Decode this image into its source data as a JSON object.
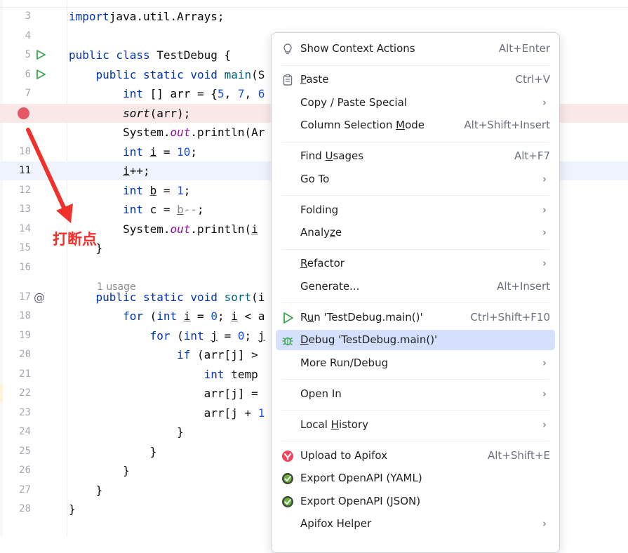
{
  "editor": {
    "usage_hint": "1 usage",
    "line_numbers": [
      "3",
      "4",
      "5",
      "6",
      "7",
      "",
      "",
      "10",
      "11",
      "12",
      "13",
      "14",
      "15",
      "16",
      "17",
      "18",
      "19",
      "20",
      "21",
      "22",
      "23",
      "24",
      "25",
      "26",
      "27",
      "28"
    ],
    "lines": [
      {
        "ln": "3",
        "parts": [
          [
            "kw",
            "import"
          ],
          [
            "",
            "java.util.Arrays;"
          ]
        ]
      },
      {
        "ln": "4",
        "parts": []
      },
      {
        "ln": "5",
        "parts": [
          [
            "kw",
            "public class"
          ],
          [
            "",
            " TestDebug {"
          ]
        ]
      },
      {
        "ln": "6",
        "parts": [
          [
            "",
            "    "
          ],
          [
            "kw",
            "public static void"
          ],
          [
            "",
            " "
          ],
          [
            "method",
            "main"
          ],
          [
            "",
            "(S"
          ]
        ]
      },
      {
        "ln": "7",
        "parts": [
          [
            "",
            "        "
          ],
          [
            "kw",
            "int"
          ],
          [
            "",
            " [] arr = {"
          ],
          [
            "num",
            "5"
          ],
          [
            "",
            ", "
          ],
          [
            "num",
            "7"
          ],
          [
            "",
            ", "
          ],
          [
            "num",
            "6"
          ]
        ]
      },
      {
        "ln": "",
        "parts": [
          [
            "",
            "        "
          ],
          [
            "it",
            "sort"
          ],
          [
            "",
            "(arr);"
          ]
        ]
      },
      {
        "ln": "9",
        "parts": [
          [
            "",
            "        System."
          ],
          [
            "field",
            "out"
          ],
          [
            "",
            ".println(Ar"
          ]
        ]
      },
      {
        "ln": "10",
        "parts": [
          [
            "",
            "        "
          ],
          [
            "kw",
            "int"
          ],
          [
            "",
            " "
          ],
          [
            "ul",
            "i"
          ],
          [
            "",
            " = "
          ],
          [
            "num",
            "10"
          ],
          [
            "",
            ";"
          ]
        ]
      },
      {
        "ln": "11",
        "parts": [
          [
            "",
            "        "
          ],
          [
            "ul",
            "i"
          ],
          [
            "",
            "++;"
          ]
        ]
      },
      {
        "ln": "12",
        "parts": [
          [
            "",
            "        "
          ],
          [
            "kw",
            "int"
          ],
          [
            "",
            " "
          ],
          [
            "ul",
            "b"
          ],
          [
            "",
            " = "
          ],
          [
            "num",
            "1"
          ],
          [
            "",
            ";"
          ]
        ]
      },
      {
        "ln": "13",
        "parts": [
          [
            "",
            "        "
          ],
          [
            "kw",
            "int"
          ],
          [
            "",
            " c = "
          ],
          [
            "uldim",
            "b"
          ],
          [
            "dim",
            "--"
          ],
          [
            "",
            ";"
          ]
        ]
      },
      {
        "ln": "14",
        "parts": [
          [
            "",
            "        System."
          ],
          [
            "field",
            "out"
          ],
          [
            "",
            ".println("
          ],
          [
            "ul",
            "i"
          ]
        ]
      },
      {
        "ln": "15",
        "parts": [
          [
            "",
            "    }"
          ]
        ]
      },
      {
        "ln": "16",
        "parts": []
      },
      {
        "ln": "17",
        "parts": [
          [
            "",
            "    "
          ],
          [
            "kw",
            "public static void"
          ],
          [
            "",
            " "
          ],
          [
            "method",
            "sort"
          ],
          [
            "",
            "(i"
          ]
        ]
      },
      {
        "ln": "18",
        "parts": [
          [
            "",
            "        "
          ],
          [
            "kw",
            "for"
          ],
          [
            "",
            " ("
          ],
          [
            "kw",
            "int"
          ],
          [
            "",
            " "
          ],
          [
            "ul",
            "i"
          ],
          [
            "",
            " = "
          ],
          [
            "num",
            "0"
          ],
          [
            "",
            "; "
          ],
          [
            "ul",
            "i"
          ],
          [
            "",
            " < a"
          ]
        ]
      },
      {
        "ln": "19",
        "parts": [
          [
            "",
            "            "
          ],
          [
            "kw",
            "for"
          ],
          [
            "",
            " ("
          ],
          [
            "kw",
            "int"
          ],
          [
            "",
            " "
          ],
          [
            "ul",
            "j"
          ],
          [
            "",
            " = "
          ],
          [
            "num",
            "0"
          ],
          [
            "",
            "; "
          ],
          [
            "ul",
            "j"
          ]
        ]
      },
      {
        "ln": "20",
        "parts": [
          [
            "",
            "                "
          ],
          [
            "kw",
            "if"
          ],
          [
            "",
            " (arr[j] >"
          ]
        ]
      },
      {
        "ln": "21",
        "parts": [
          [
            "",
            "                    "
          ],
          [
            "kw",
            "int"
          ],
          [
            "",
            " temp"
          ]
        ]
      },
      {
        "ln": "22",
        "parts": [
          [
            "",
            "                    arr[j] ="
          ]
        ]
      },
      {
        "ln": "23",
        "parts": [
          [
            "",
            "                    arr[j + "
          ],
          [
            "num",
            "1"
          ]
        ]
      },
      {
        "ln": "24",
        "parts": [
          [
            "",
            "                }"
          ]
        ]
      },
      {
        "ln": "25",
        "parts": [
          [
            "",
            "            }"
          ]
        ]
      },
      {
        "ln": "26",
        "parts": [
          [
            "",
            "        }"
          ]
        ]
      },
      {
        "ln": "27",
        "parts": [
          [
            "",
            "    }"
          ]
        ]
      },
      {
        "ln": "28",
        "parts": [
          [
            "",
            "}"
          ]
        ]
      }
    ],
    "annotation": "打断点"
  },
  "context_menu": {
    "items": [
      {
        "id": "show-context-actions",
        "icon": "lightbulb-icon",
        "label": "Show Context Actions",
        "shortcut": "Alt+Enter"
      },
      {
        "sep": true
      },
      {
        "id": "paste",
        "icon": "clipboard-icon",
        "label": "Paste",
        "shortcut": "Ctrl+V"
      },
      {
        "id": "copy-paste-special",
        "label": "Copy / Paste Special",
        "submenu": true
      },
      {
        "id": "column-selection-mode",
        "label": "Column Selection Mode",
        "shortcut": "Alt+Shift+Insert"
      },
      {
        "sep": true
      },
      {
        "id": "find-usages",
        "label": "Find Usages",
        "shortcut": "Alt+F7"
      },
      {
        "id": "go-to",
        "label": "Go To",
        "submenu": true
      },
      {
        "sep": true
      },
      {
        "id": "folding",
        "label": "Folding",
        "submenu": true
      },
      {
        "id": "analyze",
        "label": "Analyze",
        "submenu": true
      },
      {
        "sep": true
      },
      {
        "id": "refactor",
        "label": "Refactor",
        "submenu": true
      },
      {
        "id": "generate",
        "label": "Generate...",
        "shortcut": "Alt+Insert"
      },
      {
        "sep": true
      },
      {
        "id": "run",
        "icon": "run-icon",
        "label": "Run 'TestDebug.main()'",
        "shortcut": "Ctrl+Shift+F10"
      },
      {
        "id": "debug",
        "icon": "debug-bug-icon",
        "label": "Debug 'TestDebug.main()'",
        "highlighted": true
      },
      {
        "id": "more-run-debug",
        "label": "More Run/Debug",
        "submenu": true
      },
      {
        "sep": true
      },
      {
        "id": "open-in",
        "label": "Open In",
        "submenu": true
      },
      {
        "sep": true
      },
      {
        "id": "local-history",
        "label": "Local History",
        "submenu": true
      },
      {
        "sep": true
      },
      {
        "id": "upload-to-apifox",
        "icon": "apifox-icon",
        "label": "Upload to Apifox",
        "shortcut": "Alt+Shift+E"
      },
      {
        "id": "export-openapi-yaml",
        "icon": "openapi-icon",
        "label": "Export OpenAPI (YAML)"
      },
      {
        "id": "export-openapi-json",
        "icon": "openapi-icon",
        "label": "Export OpenAPI (JSON)"
      },
      {
        "id": "apifox-helper",
        "label": "Apifox Helper",
        "submenu": true
      }
    ]
  },
  "colors": {
    "breakpoint": "#e55765",
    "run_green": "#3fa550",
    "menu_highlight": "#d5e1fc",
    "annotation_red": "#f0302a"
  }
}
